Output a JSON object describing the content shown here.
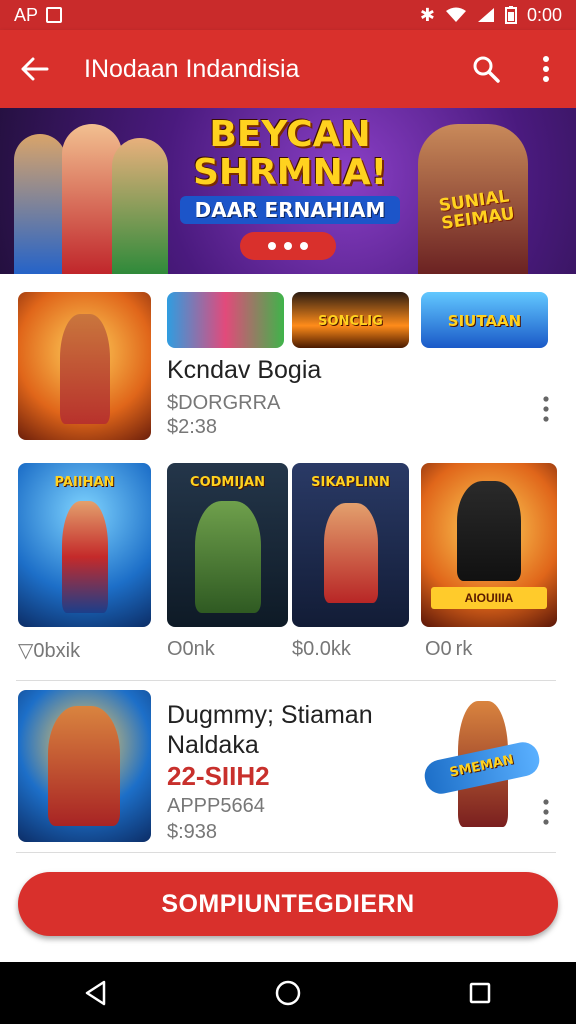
{
  "status": {
    "left_text": "AP",
    "time": "0:00"
  },
  "appbar": {
    "title": "INodaan Indandisia",
    "back_icon": "arrow-left-icon",
    "search_icon": "search-icon",
    "menu_icon": "more-vertical-icon"
  },
  "banner": {
    "headline_line1": "BEYCAN",
    "headline_line2": "SHRMNA!",
    "tagline": "DAAR ERNAHIAM",
    "side_line1": "SUNIAL",
    "side_line2": "SEIMAU"
  },
  "featured": {
    "main_tag": "",
    "mini_tags": [
      "",
      "SONCLIG",
      "SIUTAAN"
    ],
    "title": "Kcndav Bogia",
    "line1": "$DORGRRA",
    "line2": "$2:38"
  },
  "grid": {
    "tiles": [
      {
        "tag": "PAIIHAN",
        "price": "▽0bxik"
      },
      {
        "tag": "CODMIJAN",
        "price": "O0nk"
      },
      {
        "tag": "SIKAPLINN",
        "price": "$0.0kk"
      },
      {
        "tag": "AIOUIIIA",
        "price": "O0 rk"
      }
    ]
  },
  "app2": {
    "title1": "Dugmmy; Stiaman",
    "title2": "Naldaka",
    "red": "22-SIIH2",
    "line1": "APPP5664",
    "line2": "$:938",
    "side_tag": "SMEMAN"
  },
  "cta": {
    "label": "SOMPIUNTEGDIERN"
  },
  "colors": {
    "primary": "#d9302c",
    "status": "#c92b2b",
    "accent": "#ffd21f"
  }
}
